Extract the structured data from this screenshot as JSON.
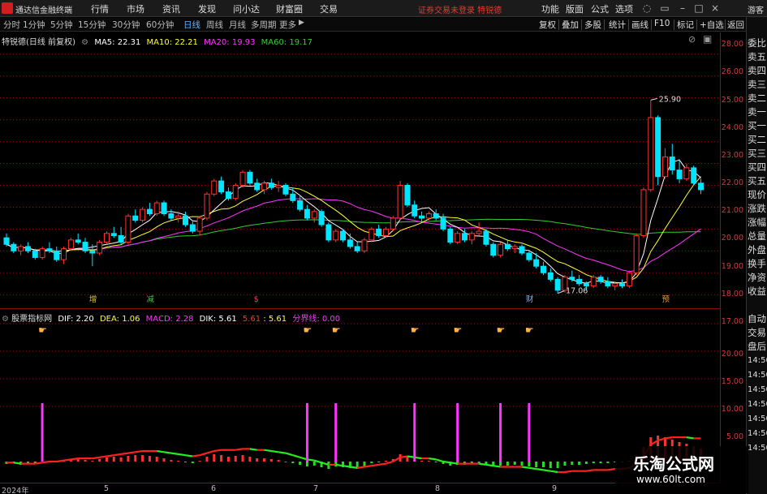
{
  "app": {
    "title": "通达信金融终端"
  },
  "menu": [
    "行情",
    "市场",
    "资讯",
    "发现",
    "问小达",
    "财富圈",
    "交易"
  ],
  "notice": "证券交易未登录  特锐德",
  "right_menu": [
    "功能",
    "版面",
    "公式",
    "选项"
  ],
  "guest_label": "游客",
  "periods": [
    "分时",
    "1分钟",
    "5分钟",
    "15分钟",
    "30分钟",
    "60分钟",
    "日线",
    "周线",
    "月线",
    "多周期",
    "更多"
  ],
  "active_period": "日线",
  "right_tools": [
    "复权",
    "叠加",
    "多股",
    "统计",
    "画线",
    "F10",
    "标记",
    "+自选",
    "返回"
  ],
  "main_legend": {
    "name": "特锐德(日线 前复权)",
    "ma5": "MA5: 22.31",
    "ma10": "MA10: 22.21",
    "ma20": "MA20: 19.93",
    "ma60": "MA60: 19.17"
  },
  "colors": {
    "up": "#ff3232",
    "down": "#00e5ff",
    "ma5": "#ffffff",
    "ma10": "#ffff33",
    "ma20": "#ff33ff",
    "ma60": "#33cc33",
    "grid": "#8b1010"
  },
  "price_ticks": [
    "28.00",
    "27.00",
    "26.00",
    "25.00",
    "24.00",
    "23.00",
    "22.00",
    "21.00",
    "20.00",
    "19.00",
    "18.00",
    "17.00"
  ],
  "annotations": {
    "high": "25.90",
    "low": "17.06"
  },
  "event_markers": [
    "增",
    "减",
    "$",
    "财",
    "预"
  ],
  "sub_legend": {
    "name": "股票指标网",
    "dif": "DIF: 2.20",
    "dea": "DEA: 1.06",
    "macd": "MACD: 2.28",
    "dik": "DIK: 5.61",
    "v1": "5.61",
    "v2": ": 5.61",
    "fen": "分界线: 0.00"
  },
  "sub_ticks": [
    "20.00",
    "15.00",
    "10.00",
    "5.00"
  ],
  "x_labels": [
    "2024年",
    "5",
    "6",
    "7",
    "8",
    "9"
  ],
  "side_items": [
    "委比",
    "卖五",
    "卖四",
    "卖三",
    "卖二",
    "卖一",
    "买一",
    "买二",
    "买三",
    "买四",
    "买五",
    "现价",
    "涨跌",
    "涨幅",
    "总量",
    "外盘",
    "换手",
    "净资",
    "收益",
    "自动",
    "交易",
    "盘后"
  ],
  "side_numbers": [
    "14:50",
    "14:50",
    "14:50",
    "14:50",
    "14:50",
    "14:50",
    "14:50"
  ],
  "watermark": {
    "title": "乐淘公式网",
    "url": "www.60lt.com"
  },
  "chart_data": {
    "type": "candlestick",
    "title": "特锐德(日线 前复权)",
    "ylim": [
      16.6,
      28.4
    ],
    "ma": {
      "MA5": 22.31,
      "MA10": 22.21,
      "MA20": 19.93,
      "MA60": 19.17
    },
    "candles": [
      [
        19.6,
        19.8,
        19.2,
        19.3
      ],
      [
        19.3,
        19.4,
        18.9,
        19.0
      ],
      [
        19.0,
        19.3,
        18.8,
        19.2
      ],
      [
        19.2,
        19.4,
        18.9,
        19.0
      ],
      [
        19.0,
        19.1,
        18.6,
        18.7
      ],
      [
        18.7,
        19.2,
        18.6,
        19.1
      ],
      [
        19.1,
        19.4,
        18.9,
        19.0
      ],
      [
        19.0,
        19.2,
        18.5,
        18.6
      ],
      [
        18.6,
        19.2,
        18.4,
        19.1
      ],
      [
        19.1,
        19.6,
        19.0,
        19.5
      ],
      [
        19.5,
        19.8,
        19.3,
        19.4
      ],
      [
        19.4,
        19.6,
        18.9,
        19.0
      ],
      [
        19.0,
        19.3,
        18.3,
        18.9
      ],
      [
        18.9,
        19.5,
        18.8,
        19.4
      ],
      [
        19.4,
        19.9,
        19.3,
        19.8
      ],
      [
        19.8,
        20.1,
        19.6,
        19.7
      ],
      [
        19.7,
        20.1,
        19.3,
        19.4
      ],
      [
        19.4,
        20.7,
        19.3,
        20.6
      ],
      [
        20.6,
        20.9,
        20.3,
        20.4
      ],
      [
        20.4,
        21.0,
        20.3,
        20.9
      ],
      [
        20.9,
        21.2,
        20.6,
        20.7
      ],
      [
        20.7,
        21.3,
        20.6,
        21.2
      ],
      [
        21.2,
        21.3,
        20.6,
        20.7
      ],
      [
        20.7,
        20.9,
        20.4,
        20.5
      ],
      [
        20.5,
        20.8,
        20.3,
        20.6
      ],
      [
        20.6,
        20.8,
        20.1,
        20.2
      ],
      [
        20.2,
        20.4,
        19.8,
        19.9
      ],
      [
        19.9,
        20.6,
        19.7,
        20.5
      ],
      [
        20.5,
        21.7,
        20.4,
        21.6
      ],
      [
        21.6,
        22.3,
        21.5,
        22.2
      ],
      [
        22.2,
        22.4,
        21.6,
        21.7
      ],
      [
        21.7,
        21.9,
        21.3,
        21.4
      ],
      [
        21.4,
        22.1,
        21.3,
        22.0
      ],
      [
        22.0,
        22.7,
        21.9,
        22.6
      ],
      [
        22.6,
        22.7,
        22.0,
        22.1
      ],
      [
        22.1,
        22.3,
        21.7,
        21.8
      ],
      [
        21.8,
        22.2,
        21.6,
        22.1
      ],
      [
        22.1,
        22.3,
        21.8,
        21.9
      ],
      [
        21.9,
        22.2,
        21.7,
        22.0
      ],
      [
        22.0,
        22.1,
        21.5,
        21.6
      ],
      [
        21.6,
        21.9,
        21.2,
        21.3
      ],
      [
        21.3,
        21.5,
        20.8,
        20.9
      ],
      [
        20.9,
        21.1,
        20.4,
        20.5
      ],
      [
        20.5,
        20.9,
        20.3,
        20.8
      ],
      [
        20.8,
        20.9,
        20.1,
        20.2
      ],
      [
        20.2,
        20.3,
        19.4,
        19.5
      ],
      [
        19.5,
        20.0,
        19.4,
        19.9
      ],
      [
        19.9,
        20.0,
        19.4,
        19.5
      ],
      [
        19.5,
        19.8,
        19.1,
        19.2
      ],
      [
        19.2,
        19.4,
        18.9,
        19.0
      ],
      [
        19.0,
        19.6,
        18.9,
        19.5
      ],
      [
        19.5,
        20.1,
        19.4,
        20.0
      ],
      [
        20.0,
        20.2,
        19.6,
        19.7
      ],
      [
        19.7,
        20.1,
        19.6,
        20.0
      ],
      [
        20.0,
        20.6,
        19.9,
        20.5
      ],
      [
        20.5,
        22.2,
        20.4,
        22.0
      ],
      [
        22.0,
        22.1,
        21.0,
        21.1
      ],
      [
        21.1,
        21.3,
        20.5,
        20.6
      ],
      [
        20.6,
        20.8,
        20.3,
        20.5
      ],
      [
        20.5,
        20.8,
        20.4,
        20.7
      ],
      [
        20.7,
        20.9,
        20.4,
        20.5
      ],
      [
        20.5,
        20.7,
        19.9,
        20.0
      ],
      [
        20.0,
        20.1,
        19.3,
        19.4
      ],
      [
        19.4,
        19.9,
        19.3,
        19.8
      ],
      [
        19.8,
        20.0,
        19.4,
        19.5
      ],
      [
        19.5,
        19.9,
        19.3,
        19.8
      ],
      [
        19.8,
        20.3,
        19.7,
        19.9
      ],
      [
        19.9,
        20.0,
        19.2,
        19.3
      ],
      [
        19.3,
        19.4,
        18.7,
        18.8
      ],
      [
        18.8,
        19.4,
        18.7,
        19.3
      ],
      [
        19.3,
        19.5,
        19.0,
        19.1
      ],
      [
        19.1,
        19.3,
        18.9,
        19.2
      ],
      [
        19.2,
        19.3,
        18.8,
        18.9
      ],
      [
        18.9,
        19.0,
        18.5,
        18.6
      ],
      [
        18.6,
        18.9,
        18.2,
        18.3
      ],
      [
        18.3,
        18.5,
        17.9,
        18.0
      ],
      [
        18.0,
        18.2,
        17.6,
        17.7
      ],
      [
        17.7,
        17.8,
        17.06,
        17.2
      ],
      [
        17.2,
        17.9,
        17.1,
        17.8
      ],
      [
        17.8,
        18.1,
        17.6,
        17.7
      ],
      [
        17.7,
        17.9,
        17.4,
        17.5
      ],
      [
        17.5,
        17.6,
        17.2,
        17.4
      ],
      [
        17.4,
        17.9,
        17.3,
        17.8
      ],
      [
        17.8,
        17.9,
        17.5,
        17.6
      ],
      [
        17.6,
        17.8,
        17.3,
        17.4
      ],
      [
        17.4,
        17.6,
        17.2,
        17.5
      ],
      [
        17.5,
        17.7,
        17.3,
        17.4
      ],
      [
        17.4,
        18.1,
        17.3,
        18.0
      ],
      [
        18.0,
        19.8,
        17.9,
        19.7
      ],
      [
        19.7,
        21.9,
        19.6,
        21.8
      ],
      [
        21.8,
        25.9,
        21.7,
        25.1
      ],
      [
        25.1,
        25.2,
        22.0,
        22.4
      ],
      [
        22.4,
        23.7,
        22.3,
        23.3
      ],
      [
        23.3,
        23.9,
        22.5,
        22.7
      ],
      [
        22.7,
        23.2,
        22.1,
        22.3
      ],
      [
        22.3,
        23.0,
        22.2,
        22.8
      ],
      [
        22.8,
        22.9,
        22.0,
        22.1
      ],
      [
        22.1,
        22.3,
        21.6,
        21.8
      ]
    ],
    "macd_hist": [
      -0.3,
      -0.2,
      -0.4,
      -0.3,
      -0.2,
      0.1,
      0.1,
      -0.1,
      0.1,
      0.3,
      0.4,
      0.2,
      0.1,
      0.3,
      0.5,
      0.6,
      0.5,
      0.7,
      0.8,
      0.8,
      0.7,
      0.6,
      0.4,
      0.2,
      0.1,
      -0.1,
      -0.2,
      0.1,
      0.6,
      0.9,
      0.8,
      0.6,
      0.7,
      0.8,
      0.6,
      0.4,
      0.4,
      0.3,
      0.2,
      0.0,
      -0.2,
      -0.4,
      -0.6,
      -0.5,
      -0.7,
      -0.9,
      -0.6,
      -0.7,
      -0.8,
      -0.9,
      -0.6,
      -0.2,
      -0.1,
      0.1,
      0.3,
      0.9,
      0.6,
      0.2,
      0.1,
      0.1,
      -0.1,
      -0.3,
      -0.5,
      -0.4,
      -0.4,
      -0.3,
      -0.2,
      -0.4,
      -0.6,
      -0.5,
      -0.5,
      -0.4,
      -0.5,
      -0.6,
      -0.7,
      -0.7,
      -0.8,
      -0.8,
      -0.5,
      -0.4,
      -0.4,
      -0.3,
      -0.2,
      -0.2,
      -0.2,
      -0.1,
      -0.1,
      0.1,
      0.8,
      1.8,
      3.0,
      3.2,
      3.0,
      2.7,
      2.4,
      2.2,
      1.9,
      1.6
    ],
    "dif": [
      -0.1,
      -0.1,
      -0.2,
      -0.2,
      -0.2,
      -0.1,
      0.0,
      0.0,
      0.1,
      0.2,
      0.3,
      0.3,
      0.3,
      0.4,
      0.5,
      0.6,
      0.7,
      0.8,
      0.9,
      1.0,
      1.0,
      1.0,
      0.9,
      0.8,
      0.7,
      0.6,
      0.5,
      0.6,
      0.8,
      1.0,
      1.1,
      1.1,
      1.1,
      1.2,
      1.2,
      1.1,
      1.1,
      1.0,
      0.9,
      0.8,
      0.6,
      0.4,
      0.2,
      0.1,
      -0.1,
      -0.3,
      -0.3,
      -0.4,
      -0.5,
      -0.6,
      -0.5,
      -0.4,
      -0.3,
      -0.2,
      0.0,
      0.4,
      0.5,
      0.4,
      0.3,
      0.3,
      0.2,
      0.0,
      -0.1,
      -0.2,
      -0.2,
      -0.2,
      -0.2,
      -0.3,
      -0.4,
      -0.5,
      -0.5,
      -0.5,
      -0.5,
      -0.6,
      -0.7,
      -0.8,
      -0.9,
      -1.0,
      -1.0,
      -0.9,
      -0.9,
      -0.9,
      -0.8,
      -0.8,
      -0.8,
      -0.7,
      -0.7,
      -0.6,
      -0.2,
      0.5,
      1.6,
      2.0,
      2.2,
      2.3,
      2.3,
      2.3,
      2.2,
      2.2
    ]
  }
}
